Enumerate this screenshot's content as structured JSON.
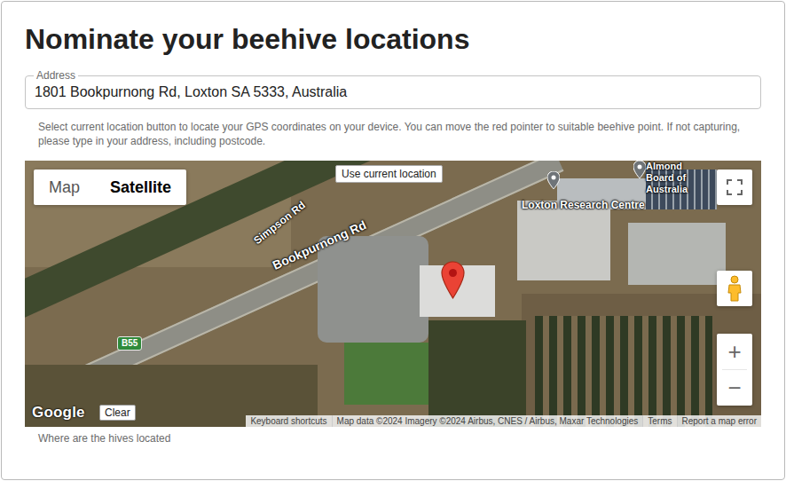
{
  "page": {
    "title": "Nominate your beehive locations"
  },
  "address": {
    "label": "Address",
    "value": "1801 Bookpurnong Rd, Loxton SA 5333, Australia"
  },
  "help_text": "Select current location button to locate your GPS coordinates on your device. You can move the red pointer to suitable beehive point. If not capturing, please type in your address, including postcode.",
  "map": {
    "type_buttons": [
      {
        "label": "Map",
        "selected": false
      },
      {
        "label": "Satellite",
        "selected": true
      }
    ],
    "current_location_button": "Use current location",
    "labels": [
      {
        "text": "Simpson Rd",
        "kind": "road"
      },
      {
        "text": "Bookpurnong Rd",
        "kind": "road"
      },
      {
        "text": "B55",
        "kind": "shield"
      },
      {
        "text": "Loxton Research Centre",
        "kind": "place"
      },
      {
        "text": "Almond Board of Australia",
        "kind": "place"
      }
    ],
    "zoom_in": "+",
    "zoom_out": "−",
    "logo": "Google",
    "clear_button": "Clear",
    "attribution": [
      "Keyboard shortcuts",
      "Map data ©2024 Imagery ©2024 Airbus, CNES / Airbus, Maxar Technologies",
      "Terms",
      "Report a map error"
    ]
  },
  "caption": "Where are the hives located"
}
